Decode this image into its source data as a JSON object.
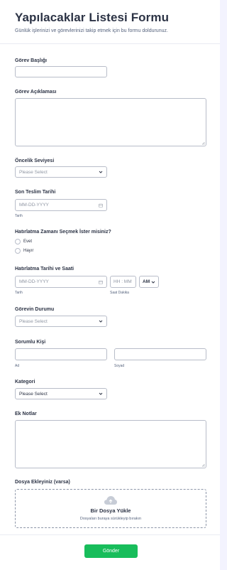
{
  "header": {
    "title": "Yapılacaklar Listesi Formu",
    "subtitle": "Günlük işlerinizi ve görevlerinizi takip etmek için bu formu doldurunuz."
  },
  "fields": {
    "task_title": {
      "label": "Görev Başlığı",
      "value": ""
    },
    "task_description": {
      "label": "Görev Açıklaması",
      "value": ""
    },
    "priority": {
      "label": "Öncelik Seviyesi",
      "value": "Please Select"
    },
    "due_date": {
      "label": "Son Teslim Tarihi",
      "placeholder": "MM-DD-YYYY",
      "sublabel": "Tarih"
    },
    "reminder_choice": {
      "label": "Hatırlatma Zamanı Seçmek İster misiniz?",
      "options": [
        "Evet",
        "Hayır"
      ]
    },
    "reminder_datetime": {
      "label": "Hatırlatma Tarihi ve Saati",
      "date_placeholder": "MM-DD-YYYY",
      "time_placeholder": "HH : MM",
      "ampm_value": "AM",
      "date_sublabel": "Tarih",
      "time_sublabel": "Saat Dakika"
    },
    "task_status": {
      "label": "Görevin Durumu",
      "value": "Please Select"
    },
    "responsible": {
      "label": "Sorumlu Kişi",
      "first_sublabel": "Ad",
      "last_sublabel": "Soyad"
    },
    "category": {
      "label": "Kategori",
      "value": "Please Select"
    },
    "notes": {
      "label": "Ek Notlar",
      "value": ""
    },
    "attachment": {
      "label": "Dosya Ekleyiniz (varsa)",
      "upload_title": "Bir Dosya Yükle",
      "upload_hint": "Dosyaları buraya sürükleyip bırakın"
    }
  },
  "submit_label": "Gönder",
  "icons": {
    "select": "chevron-down-icon",
    "date": "calendar-icon",
    "upload": "cloud-upload-icon"
  },
  "colors": {
    "submit": "#18bd5b",
    "text": "#2c3345",
    "border": "#b8bdc9"
  }
}
